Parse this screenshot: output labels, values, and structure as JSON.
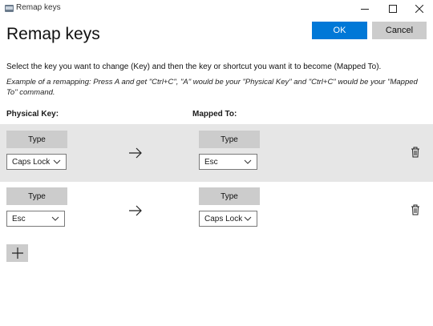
{
  "window": {
    "title": "Remap keys"
  },
  "header": {
    "heading": "Remap keys",
    "ok_label": "OK",
    "cancel_label": "Cancel"
  },
  "instructions": "Select the key you want to change (Key) and then the key or shortcut you want it to become (Mapped To).",
  "example": "Example of a remapping: Press A and get \"Ctrl+C\", \"A\" would be your \"Physical Key\" and \"Ctrl+C\" would be your \"Mapped To\" command.",
  "columns": {
    "physical": "Physical Key:",
    "mapped": "Mapped To:"
  },
  "rows": [
    {
      "physical_type": "Type",
      "physical_key": "Caps Lock",
      "mapped_type": "Type",
      "mapped_key": "Esc"
    },
    {
      "physical_type": "Type",
      "physical_key": "Esc",
      "mapped_type": "Type",
      "mapped_key": "Caps Lock"
    }
  ],
  "icons": {
    "arrow": "arrow-right-icon",
    "delete": "trash-icon",
    "add": "plus-icon"
  }
}
